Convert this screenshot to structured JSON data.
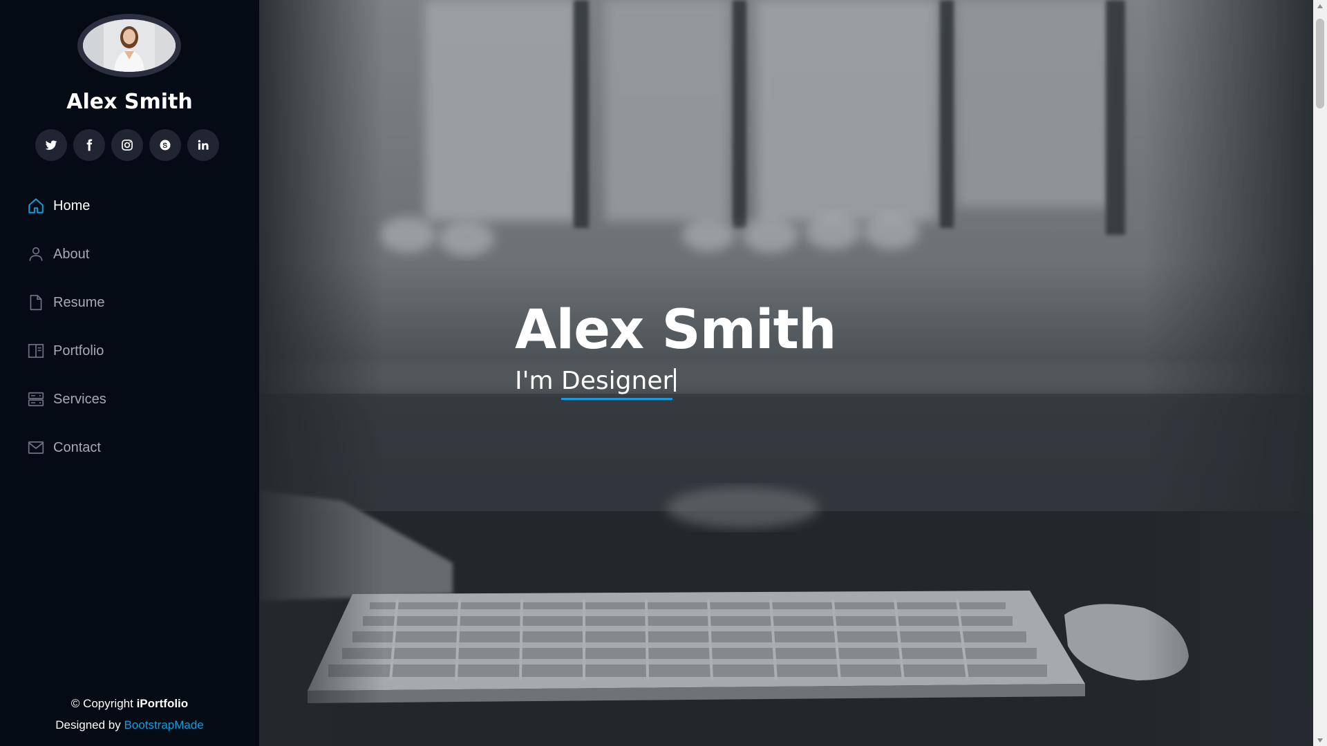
{
  "profile": {
    "name": "Alex Smith"
  },
  "social": [
    {
      "name": "twitter-icon"
    },
    {
      "name": "facebook-icon"
    },
    {
      "name": "instagram-icon"
    },
    {
      "name": "skype-icon"
    },
    {
      "name": "linkedin-icon"
    }
  ],
  "nav": {
    "items": [
      {
        "label": "Home",
        "icon": "home-icon",
        "active": true
      },
      {
        "label": "About",
        "icon": "person-icon"
      },
      {
        "label": "Resume",
        "icon": "file-icon"
      },
      {
        "label": "Portfolio",
        "icon": "book-icon"
      },
      {
        "label": "Services",
        "icon": "server-icon"
      },
      {
        "label": "Contact",
        "icon": "envelope-icon"
      }
    ]
  },
  "footer": {
    "copyright_prefix": "© Copyright ",
    "brand": "iPortfolio",
    "designed_by_prefix": "Designed by ",
    "designer": "BootstrapMade"
  },
  "hero": {
    "title": "Alex Smith",
    "prefix": "I'm ",
    "typed": "Designer"
  },
  "colors": {
    "accent": "#149ddd",
    "sidebar_bg": "#040b14",
    "social_bg": "#212431",
    "nav_text": "#a8a9b4"
  }
}
